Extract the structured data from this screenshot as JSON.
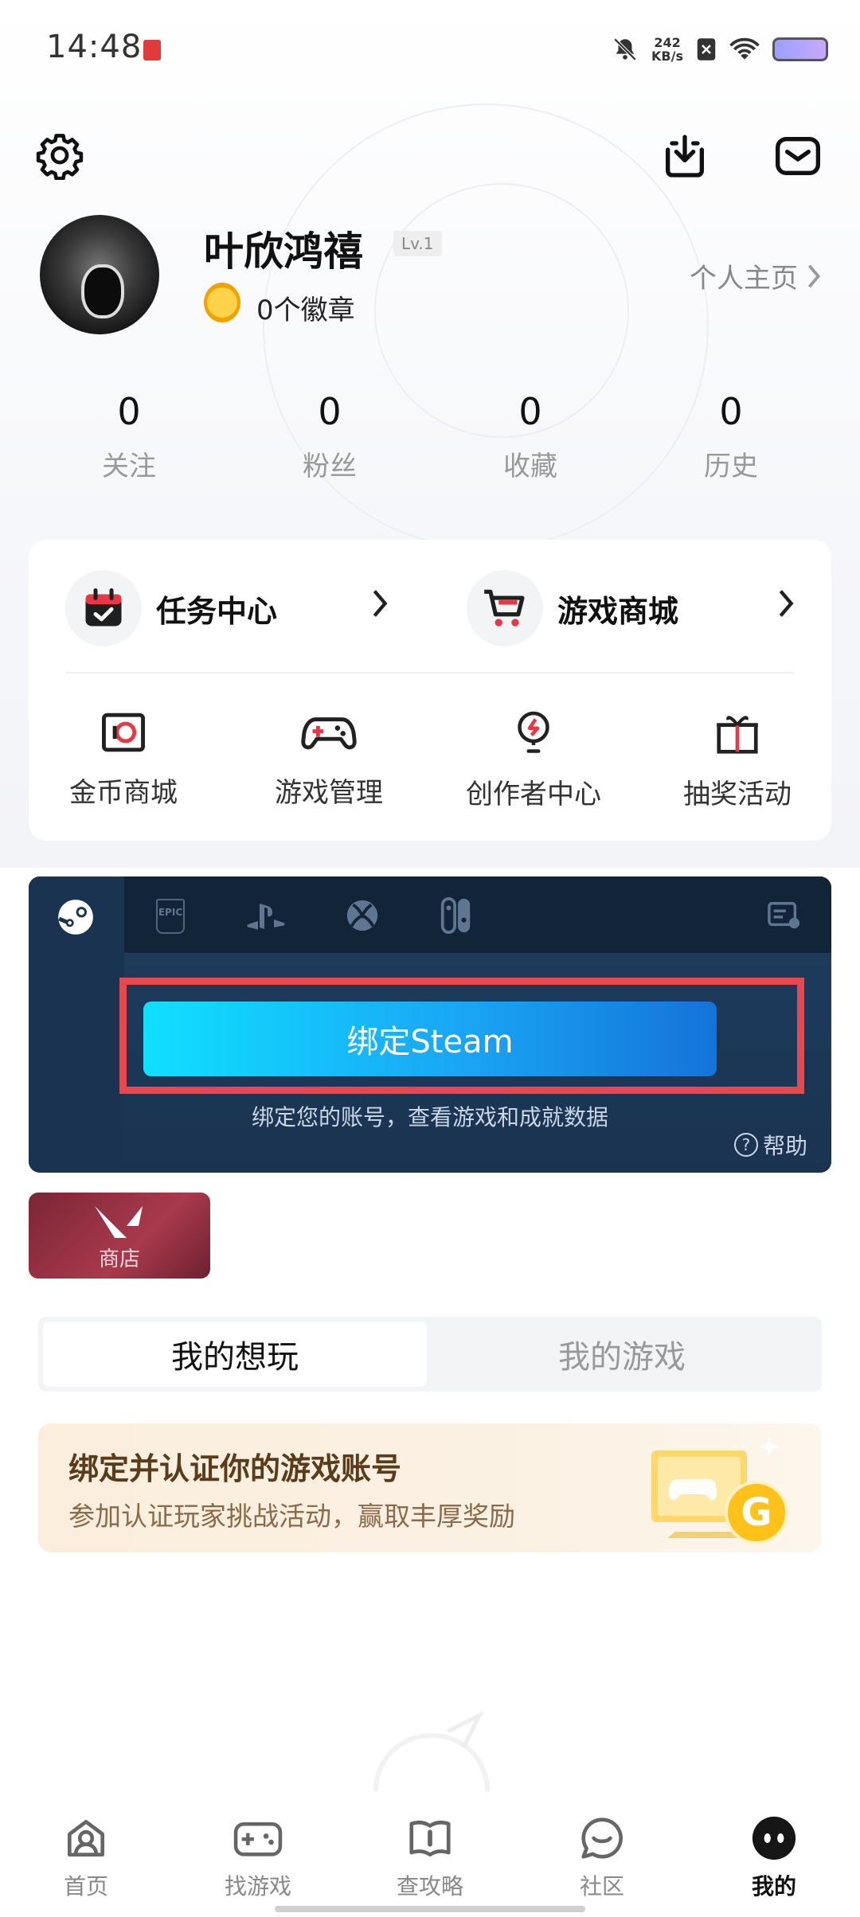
{
  "status_bar": {
    "time": "14:48",
    "speed_value": "242",
    "speed_unit": "KB/s"
  },
  "profile": {
    "username": "叶欣鸿禧",
    "level": "Lv.1",
    "badges": "0个徽章",
    "homepage_link": "个人主页"
  },
  "stats": [
    {
      "value": "0",
      "label": "关注"
    },
    {
      "value": "0",
      "label": "粉丝"
    },
    {
      "value": "0",
      "label": "收藏"
    },
    {
      "value": "0",
      "label": "历史"
    }
  ],
  "card": {
    "task_center": "任务中心",
    "game_store": "游戏商城",
    "tools": [
      {
        "label": "金币商城",
        "icon": "coin-store-icon"
      },
      {
        "label": "游戏管理",
        "icon": "gamepad-icon"
      },
      {
        "label": "创作者中心",
        "icon": "lightbulb-icon"
      },
      {
        "label": "抽奖活动",
        "icon": "gift-icon"
      }
    ]
  },
  "platform": {
    "tabs": [
      "steam",
      "epic",
      "playstation",
      "xbox",
      "switch"
    ],
    "epic_label": "EPIC",
    "bind_button": "绑定Steam",
    "description": "绑定您的账号，查看游戏和成就数据",
    "help": "帮助",
    "help_icon_glyph": "?"
  },
  "store": {
    "label": "商店"
  },
  "segment": {
    "tab_want": "我的想玩",
    "tab_games": "我的游戏"
  },
  "promo": {
    "title": "绑定并认证你的游戏账号",
    "subtitle": "参加认证玩家挑战活动，赢取丰厚奖励",
    "badge_letter": "G"
  },
  "nav": [
    {
      "label": "首页",
      "icon": "home-icon"
    },
    {
      "label": "找游戏",
      "icon": "find-game-icon"
    },
    {
      "label": "查攻略",
      "icon": "guide-icon"
    },
    {
      "label": "社区",
      "icon": "community-icon"
    },
    {
      "label": "我的",
      "icon": "profile-icon"
    }
  ],
  "colors": {
    "accent": "#1aa6f5",
    "highlight_box": "#e5484d",
    "panel": "#1a3350"
  }
}
